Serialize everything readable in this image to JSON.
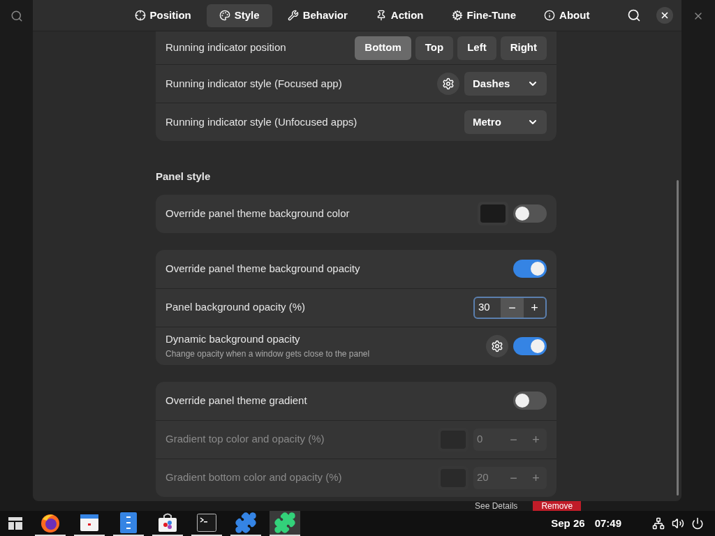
{
  "tabs": [
    {
      "label": "Position",
      "selected": false
    },
    {
      "label": "Style",
      "selected": true
    },
    {
      "label": "Behavior",
      "selected": false
    },
    {
      "label": "Action",
      "selected": false
    },
    {
      "label": "Fine-Tune",
      "selected": false
    },
    {
      "label": "About",
      "selected": false
    }
  ],
  "groups": [
    {
      "rows": [
        {
          "kind": "segmented",
          "label": "Running indicator position",
          "options": [
            {
              "label": "Bottom",
              "selected": true
            },
            {
              "label": "Top",
              "selected": false
            },
            {
              "label": "Left",
              "selected": false
            },
            {
              "label": "Right",
              "selected": false
            }
          ]
        },
        {
          "kind": "dropdown",
          "label": "Running indicator style (Focused app)",
          "gear": true,
          "value": "Dashes"
        },
        {
          "kind": "dropdown",
          "label": "Running indicator style (Unfocused apps)",
          "gear": false,
          "value": "Metro"
        }
      ]
    },
    {
      "heading": "Panel style",
      "rows": [
        {
          "kind": "toggle",
          "label": "Override panel theme background color",
          "swatch": true,
          "gear": false,
          "on": false,
          "disabled": false
        }
      ]
    },
    {
      "rows": [
        {
          "kind": "toggle",
          "label": "Override panel theme background opacity",
          "gear": false,
          "on": true,
          "disabled": false
        },
        {
          "kind": "spin",
          "label": "Panel background opacity (%)",
          "value": "30",
          "minus": "−",
          "plus": "+",
          "disabled": false,
          "focused": true
        },
        {
          "kind": "toggle",
          "label": "Dynamic background opacity",
          "sublabel": "Change opacity when a window gets close to the panel",
          "gear": true,
          "on": true,
          "disabled": false
        }
      ]
    },
    {
      "rows": [
        {
          "kind": "toggle",
          "label": "Override panel theme gradient",
          "gear": false,
          "on": false,
          "disabled": false
        },
        {
          "kind": "spin",
          "label": "Gradient top color and opacity (%)",
          "swatch": true,
          "value": "0",
          "minus": "−",
          "plus": "+",
          "disabled": true,
          "focused": false
        },
        {
          "kind": "spin",
          "label": "Gradient bottom color and opacity (%)",
          "swatch": true,
          "value": "20",
          "minus": "−",
          "plus": "+",
          "disabled": true,
          "focused": false
        }
      ]
    }
  ],
  "below": {
    "details": "See Details",
    "remove": "Remove"
  },
  "taskbar": {
    "apps": [
      {
        "selected": false
      },
      {
        "selected": false
      },
      {
        "selected": false
      },
      {
        "selected": false
      },
      {
        "selected": false
      },
      {
        "selected": false
      },
      {
        "selected": true
      }
    ],
    "date": "Sep 26",
    "time": "07:49"
  }
}
